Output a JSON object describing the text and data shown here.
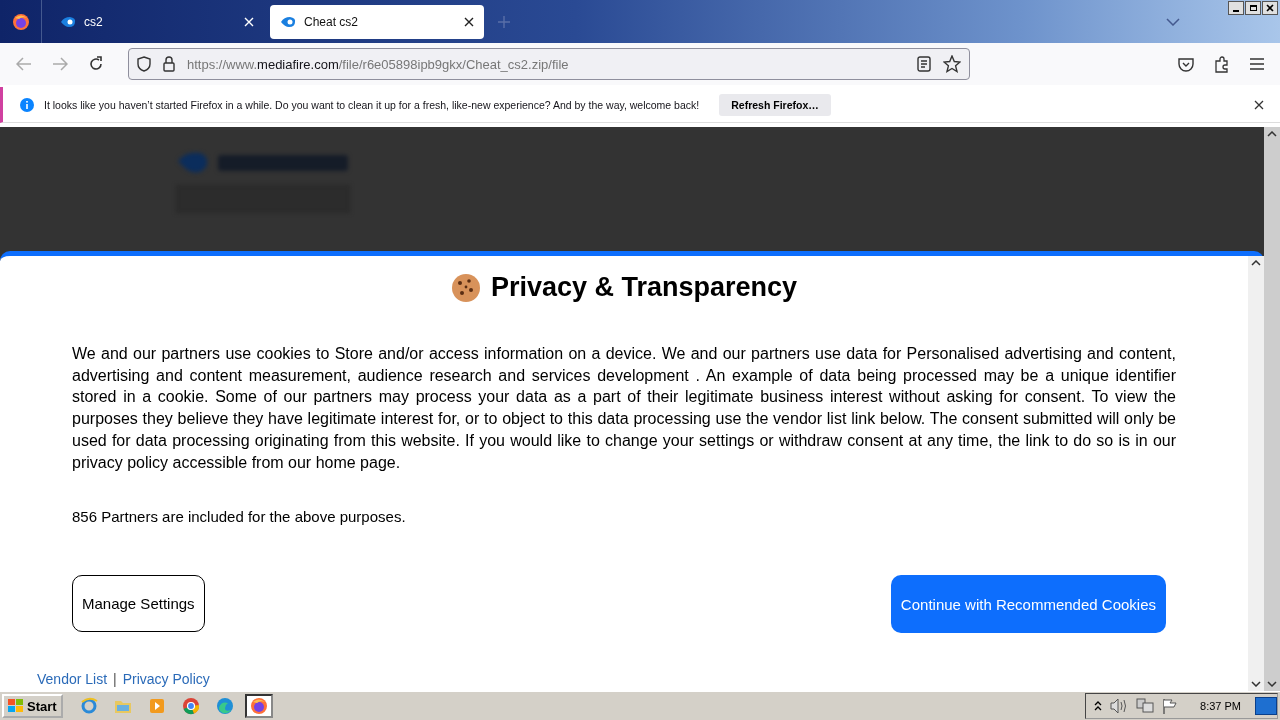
{
  "tabs": [
    {
      "title": "cs2",
      "selected": false
    },
    {
      "title": "Cheat cs2",
      "selected": true
    }
  ],
  "address_bar": {
    "prefix": "https://www.",
    "domain": "mediafire.com",
    "path": "/file/r6e05898ipb9gkx/Cheat_cs2.zip/file"
  },
  "notification": {
    "message": "It looks like you haven’t started Firefox in a while. Do you want to clean it up for a fresh, like-new experience? And by the way, welcome back!",
    "button": "Refresh Firefox…"
  },
  "dialog": {
    "title": "Privacy & Transparency",
    "body": "We and our partners use cookies to Store and/or access information on a device. We and our partners use data for Personalised advertising and content, advertising and content measurement, audience research and services development . An example of data being processed may be a unique identifier stored in a cookie. Some of our partners may process your data as a part of their legitimate business interest without asking for consent. To view the purposes they believe they have legitimate interest for, or to object to this data processing use the vendor list link below. The consent submitted will only be used for data processing originating from this website. If you would like to change your settings or withdraw consent at any time, the link to do so is in our privacy policy accessible from our home page.",
    "partners": "856 Partners are included for the above purposes.",
    "buttons": [
      {
        "label": "Manage Settings",
        "kind": "secondary"
      },
      {
        "label": "Continue with Recommended Cookies",
        "kind": "primary"
      }
    ],
    "links": [
      "Vendor List",
      "Privacy Policy"
    ],
    "link_separator": "|"
  },
  "taskbar": {
    "start": "Start",
    "apps": [
      {
        "kind": "ie",
        "selected": false
      },
      {
        "kind": "explorer",
        "selected": false
      },
      {
        "kind": "media",
        "selected": false
      },
      {
        "kind": "chrome",
        "selected": false
      },
      {
        "kind": "edge",
        "selected": false
      },
      {
        "kind": "firefox",
        "selected": true
      }
    ],
    "clock": "8:37 PM"
  }
}
